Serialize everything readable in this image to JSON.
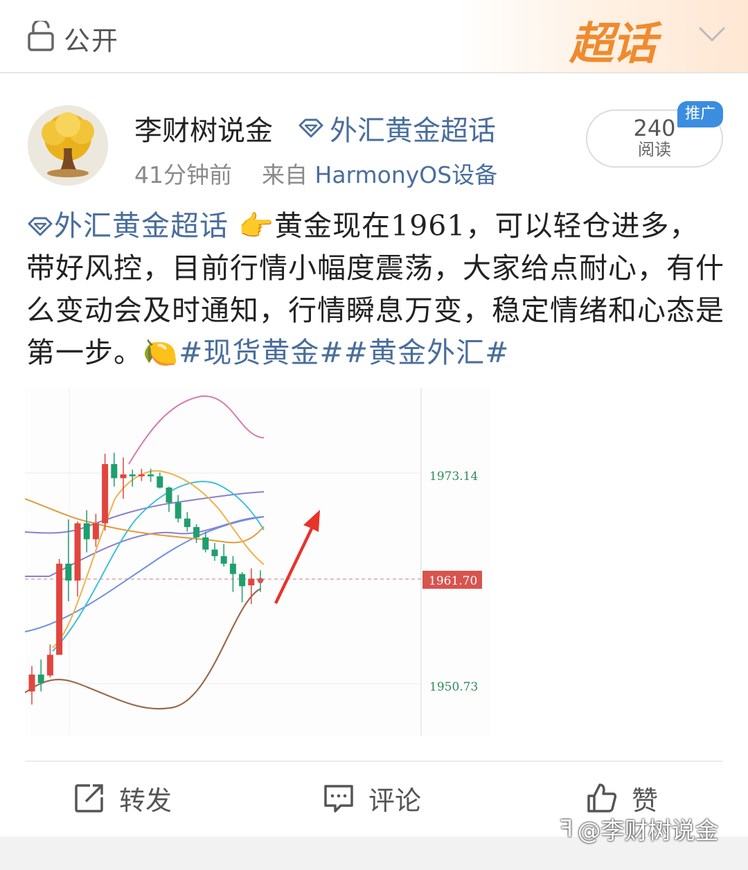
{
  "topbar": {
    "public_label": "公开",
    "supertopic_logo": "超话"
  },
  "post_header": {
    "author": "李财树说金",
    "topic": "外汇黄金超话",
    "time": "41分钟前",
    "source_prefix": "来自",
    "device": "HarmonyOS设备",
    "read_count": "240",
    "read_label": "阅读",
    "promo_badge": "推广"
  },
  "post_body": {
    "topic_inline": "外汇黄金超话",
    "pointing_emoji": "👉",
    "text": "黄金现在1961，可以轻仓进多，带好风控，目前行情小幅度震荡，大家给点耐心，有什么变动会及时通知，行情瞬息万变，稳定情绪和心态是第一步。",
    "lemon_emoji": "🍋",
    "hashtag1": "#现货黄金#",
    "hashtag2": "#黄金外汇#"
  },
  "chart_data": {
    "type": "candlestick",
    "price_labels": [
      "1973.14",
      "1961.70",
      "1950.73"
    ],
    "current_price": 1961.7,
    "current_price_color": "#d9534f",
    "up_color": "#e0463e",
    "down_color": "#1f9e6e",
    "candles": [
      {
        "o": 1949.9,
        "h": 1952.6,
        "l": 1948.5,
        "c": 1951.7
      },
      {
        "o": 1951.7,
        "h": 1953.3,
        "l": 1949.9,
        "c": 1950.8
      },
      {
        "o": 1951.6,
        "h": 1954.9,
        "l": 1951.4,
        "c": 1953.8
      },
      {
        "o": 1953.8,
        "h": 1964.0,
        "l": 1953.8,
        "c": 1963.5
      },
      {
        "o": 1963.5,
        "h": 1968.2,
        "l": 1959.5,
        "c": 1961.7
      },
      {
        "o": 1961.7,
        "h": 1968.0,
        "l": 1960.0,
        "c": 1967.8
      },
      {
        "o": 1967.8,
        "h": 1969.2,
        "l": 1964.7,
        "c": 1966.1
      },
      {
        "o": 1966.1,
        "h": 1968.8,
        "l": 1965.3,
        "c": 1967.8
      },
      {
        "o": 1967.8,
        "h": 1975.2,
        "l": 1967.0,
        "c": 1974.1
      },
      {
        "o": 1974.1,
        "h": 1975.3,
        "l": 1971.7,
        "c": 1972.6
      },
      {
        "o": 1972.6,
        "h": 1974.8,
        "l": 1970.4,
        "c": 1973.0
      },
      {
        "o": 1973.0,
        "h": 1973.5,
        "l": 1971.7,
        "c": 1972.8
      },
      {
        "o": 1972.8,
        "h": 1973.6,
        "l": 1972.3,
        "c": 1973.0
      },
      {
        "o": 1973.0,
        "h": 1973.6,
        "l": 1972.2,
        "c": 1972.8
      },
      {
        "o": 1972.8,
        "h": 1973.2,
        "l": 1971.5,
        "c": 1971.6
      },
      {
        "o": 1971.6,
        "h": 1971.7,
        "l": 1969.0,
        "c": 1970.0
      },
      {
        "o": 1970.0,
        "h": 1970.8,
        "l": 1967.9,
        "c": 1968.3
      },
      {
        "o": 1968.3,
        "h": 1969.0,
        "l": 1966.9,
        "c": 1967.4
      },
      {
        "o": 1967.4,
        "h": 1967.7,
        "l": 1965.7,
        "c": 1966.3
      },
      {
        "o": 1966.3,
        "h": 1966.9,
        "l": 1964.7,
        "c": 1965.0
      },
      {
        "o": 1965.0,
        "h": 1965.7,
        "l": 1963.8,
        "c": 1964.3
      },
      {
        "o": 1964.3,
        "h": 1965.6,
        "l": 1963.2,
        "c": 1963.5
      },
      {
        "o": 1963.5,
        "h": 1964.3,
        "l": 1960.5,
        "c": 1962.4
      },
      {
        "o": 1962.4,
        "h": 1962.6,
        "l": 1959.4,
        "c": 1961.1
      },
      {
        "o": 1961.2,
        "h": 1963.0,
        "l": 1959.2,
        "c": 1961.9
      },
      {
        "o": 1961.9,
        "h": 1962.8,
        "l": 1960.5,
        "c": 1961.7
      }
    ]
  },
  "actions": {
    "repost": "转发",
    "comment": "评论",
    "like": "赞"
  },
  "watermark": "@李财树说金"
}
